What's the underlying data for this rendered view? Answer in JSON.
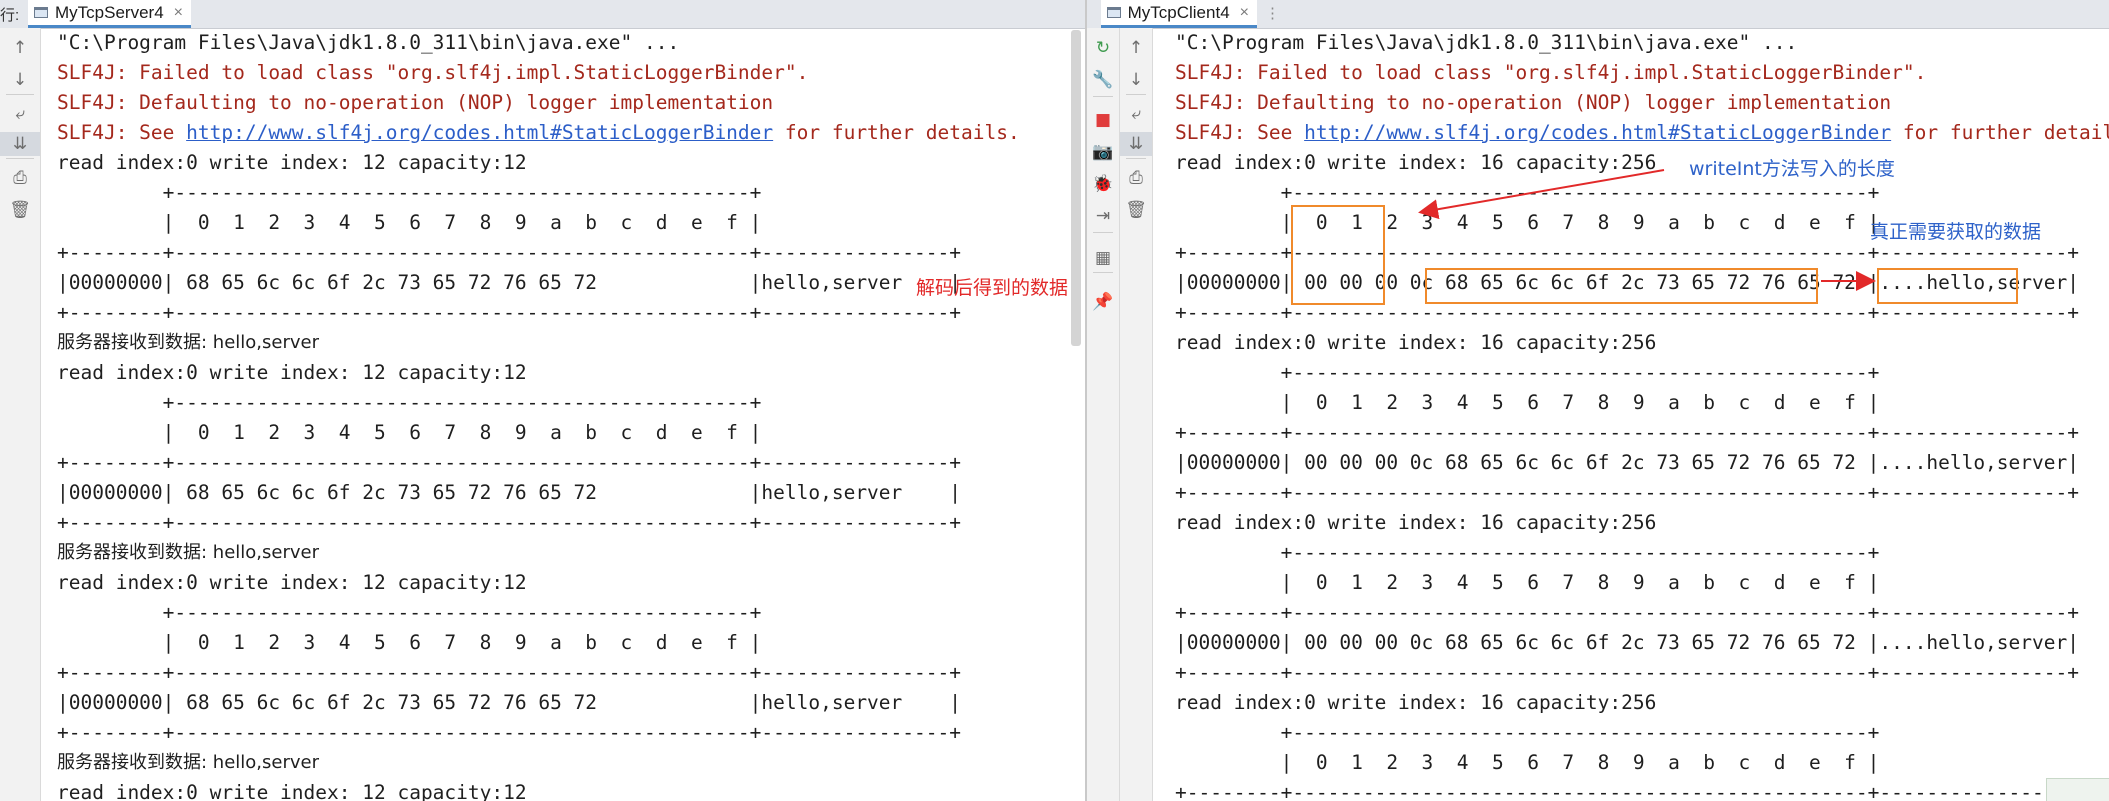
{
  "left": {
    "prefix": "行:",
    "tab_title": "MyTcpServer4",
    "tab_close": "×",
    "lines": [
      {
        "text": "\"C:\\Program Files\\Java\\jdk1.8.0_311\\bin\\java.exe\" ...",
        "type": "normal"
      },
      {
        "text": "SLF4J: Failed to load class \"org.slf4j.impl.StaticLoggerBinder\".",
        "type": "err"
      },
      {
        "text": "SLF4J: Defaulting to no-operation (NOP) logger implementation",
        "type": "err"
      },
      {
        "pre": "SLF4J: See ",
        "link": "http://www.slf4j.org/codes.html#StaticLoggerBinder",
        "post": " for further details.",
        "type": "link"
      },
      {
        "text": "read index:0 write index: 12 capacity:12",
        "type": "normal"
      },
      {
        "text": "         +-------------------------------------------------+",
        "type": "normal"
      },
      {
        "text": "         |  0  1  2  3  4  5  6  7  8  9  a  b  c  d  e  f |",
        "type": "normal"
      },
      {
        "text": "+--------+-------------------------------------------------+----------------+",
        "type": "normal"
      },
      {
        "text": "|00000000| 68 65 6c 6c 6f 2c 73 65 72 76 65 72             |hello,server    |",
        "type": "normal"
      },
      {
        "text": "+--------+-------------------------------------------------+----------------+",
        "type": "normal"
      },
      {
        "text": "服务器接收到数据: hello,server",
        "type": "cn"
      },
      {
        "text": "read index:0 write index: 12 capacity:12",
        "type": "normal"
      },
      {
        "text": "         +-------------------------------------------------+",
        "type": "normal"
      },
      {
        "text": "         |  0  1  2  3  4  5  6  7  8  9  a  b  c  d  e  f |",
        "type": "normal"
      },
      {
        "text": "+--------+-------------------------------------------------+----------------+",
        "type": "normal"
      },
      {
        "text": "|00000000| 68 65 6c 6c 6f 2c 73 65 72 76 65 72             |hello,server    |",
        "type": "normal"
      },
      {
        "text": "+--------+-------------------------------------------------+----------------+",
        "type": "normal"
      },
      {
        "text": "服务器接收到数据: hello,server",
        "type": "cn"
      },
      {
        "text": "read index:0 write index: 12 capacity:12",
        "type": "normal"
      },
      {
        "text": "         +-------------------------------------------------+",
        "type": "normal"
      },
      {
        "text": "         |  0  1  2  3  4  5  6  7  8  9  a  b  c  d  e  f |",
        "type": "normal"
      },
      {
        "text": "+--------+-------------------------------------------------+----------------+",
        "type": "normal"
      },
      {
        "text": "|00000000| 68 65 6c 6c 6f 2c 73 65 72 76 65 72             |hello,server    |",
        "type": "normal"
      },
      {
        "text": "+--------+-------------------------------------------------+----------------+",
        "type": "normal"
      },
      {
        "text": "服务器接收到数据: hello,server",
        "type": "cn"
      },
      {
        "text": "read index:0 write index: 12 capacity:12",
        "type": "normal"
      }
    ],
    "annotation": "解码后得到的数据"
  },
  "right": {
    "tab_title": "MyTcpClient4",
    "tab_close": "×",
    "tab_more": "⋮",
    "lines": [
      {
        "text": "\"C:\\Program Files\\Java\\jdk1.8.0_311\\bin\\java.exe\" ...",
        "type": "normal"
      },
      {
        "text": "SLF4J: Failed to load class \"org.slf4j.impl.StaticLoggerBinder\".",
        "type": "err"
      },
      {
        "text": "SLF4J: Defaulting to no-operation (NOP) logger implementation",
        "type": "err"
      },
      {
        "pre": "SLF4J: See ",
        "link": "http://www.slf4j.org/codes.html#StaticLoggerBinder",
        "post": " for further details.",
        "type": "link"
      },
      {
        "text": "read index:0 write index: 16 capacity:256",
        "type": "normal"
      },
      {
        "text": "         +-------------------------------------------------+",
        "type": "normal"
      },
      {
        "text": "         |  0  1  2  3  4  5  6  7  8  9  a  b  c  d  e  f |",
        "type": "normal"
      },
      {
        "text": "+--------+-------------------------------------------------+----------------+",
        "type": "normal"
      },
      {
        "text": "|00000000| 00 00 00 0c 68 65 6c 6c 6f 2c 73 65 72 76 65 72 |....hello,server|",
        "type": "normal"
      },
      {
        "text": "+--------+-------------------------------------------------+----------------+",
        "type": "normal"
      },
      {
        "text": "read index:0 write index: 16 capacity:256",
        "type": "normal"
      },
      {
        "text": "         +-------------------------------------------------+",
        "type": "normal"
      },
      {
        "text": "         |  0  1  2  3  4  5  6  7  8  9  a  b  c  d  e  f |",
        "type": "normal"
      },
      {
        "text": "+--------+-------------------------------------------------+----------------+",
        "type": "normal"
      },
      {
        "text": "|00000000| 00 00 00 0c 68 65 6c 6c 6f 2c 73 65 72 76 65 72 |....hello,server|",
        "type": "normal"
      },
      {
        "text": "+--------+-------------------------------------------------+----------------+",
        "type": "normal"
      },
      {
        "text": "read index:0 write index: 16 capacity:256",
        "type": "normal"
      },
      {
        "text": "         +-------------------------------------------------+",
        "type": "normal"
      },
      {
        "text": "         |  0  1  2  3  4  5  6  7  8  9  a  b  c  d  e  f |",
        "type": "normal"
      },
      {
        "text": "+--------+-------------------------------------------------+----------------+",
        "type": "normal"
      },
      {
        "text": "|00000000| 00 00 00 0c 68 65 6c 6c 6f 2c 73 65 72 76 65 72 |....hello,server|",
        "type": "normal"
      },
      {
        "text": "+--------+-------------------------------------------------+----------------+",
        "type": "normal"
      },
      {
        "text": "read index:0 write index: 16 capacity:256",
        "type": "normal"
      },
      {
        "text": "         +-------------------------------------------------+",
        "type": "normal"
      },
      {
        "text": "         |  0  1  2  3  4  5  6  7  8  9  a  b  c  d  e  f |",
        "type": "normal"
      },
      {
        "text": "+--------+-------------------------------------------------+----------------+",
        "type": "normal"
      }
    ],
    "annotation_writeint": "writeInt方法写入的长度",
    "annotation_data": "真正需要获取的数据"
  },
  "toolbar_icons": {
    "left": [
      "arrow-up-icon",
      "arrow-down-icon",
      "soft-wrap-icon",
      "scroll-to-end-icon",
      "print-icon",
      "trash-icon"
    ],
    "right_outer": [
      "rerun-icon",
      "wrench-icon",
      "stop-icon",
      "camera-icon",
      "debug-bug-icon",
      "login-icon",
      "layout-icon",
      "pin-icon"
    ],
    "right_inner": [
      "arrow-up-icon",
      "arrow-down-icon",
      "soft-wrap-icon",
      "scroll-to-end-icon",
      "print-icon",
      "trash-icon"
    ]
  },
  "colors": {
    "error_text": "#a4281c",
    "link": "#2c5ec8",
    "annotation_box": "#f08a2b",
    "annotation_red": "#e22929",
    "annotation_blue": "#2e62c9"
  }
}
